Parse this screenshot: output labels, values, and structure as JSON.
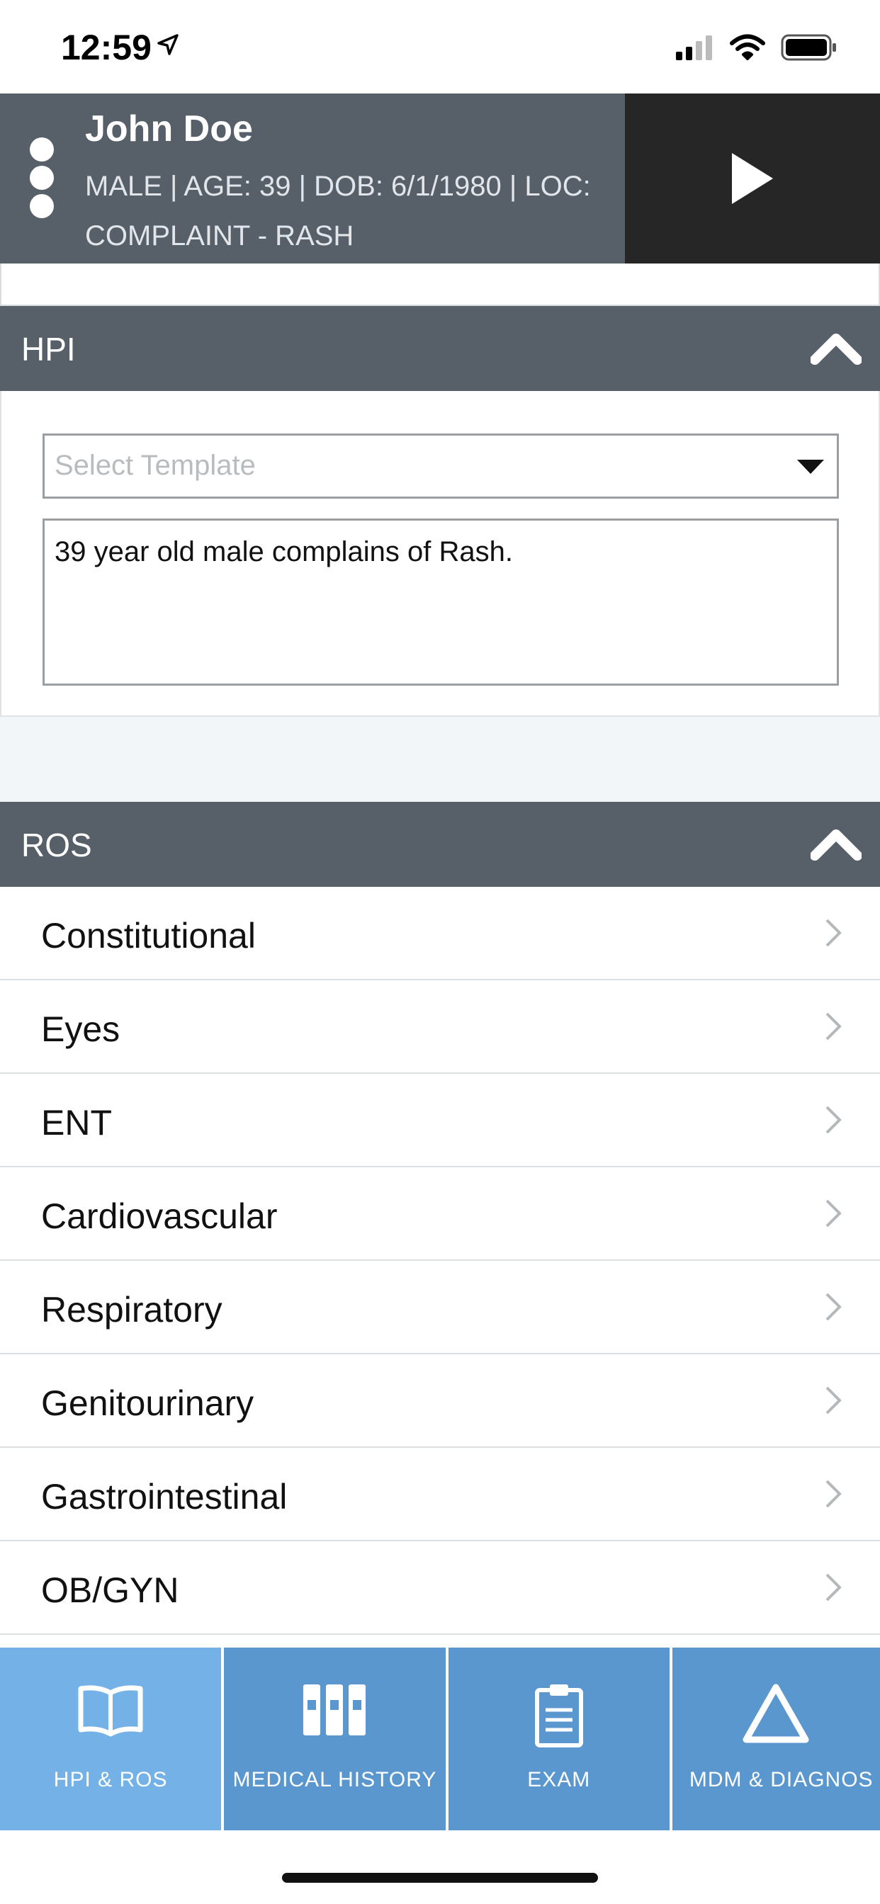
{
  "status_bar": {
    "time": "12:59"
  },
  "patient": {
    "name": "John Doe",
    "info_line1": "MALE | AGE: 39 | DOB: 6/1/1980 | LOC:",
    "info_line2": "COMPLAINT - RASH"
  },
  "hpi": {
    "title": "HPI",
    "template_placeholder": "Select Template",
    "note_text": "39 year old male complains of Rash."
  },
  "ros": {
    "title": "ROS",
    "items": [
      {
        "label": "Constitutional"
      },
      {
        "label": "Eyes"
      },
      {
        "label": "ENT"
      },
      {
        "label": "Cardiovascular"
      },
      {
        "label": "Respiratory"
      },
      {
        "label": "Genitourinary"
      },
      {
        "label": "Gastrointestinal"
      },
      {
        "label": "OB/GYN"
      }
    ]
  },
  "tabs": [
    {
      "label": "HPI & ROS",
      "icon": "book-icon",
      "active": true
    },
    {
      "label": "MEDICAL HISTORY",
      "icon": "binders-icon",
      "active": false
    },
    {
      "label": "EXAM",
      "icon": "clipboard-icon",
      "active": false
    },
    {
      "label": "MDM & DIAGNOS",
      "icon": "triangle-icon",
      "active": false
    }
  ],
  "colors": {
    "header_bg": "#576069",
    "tab_bg": "#5b97cf",
    "tab_active_bg": "#74b1e6",
    "play_bg": "#262626"
  }
}
